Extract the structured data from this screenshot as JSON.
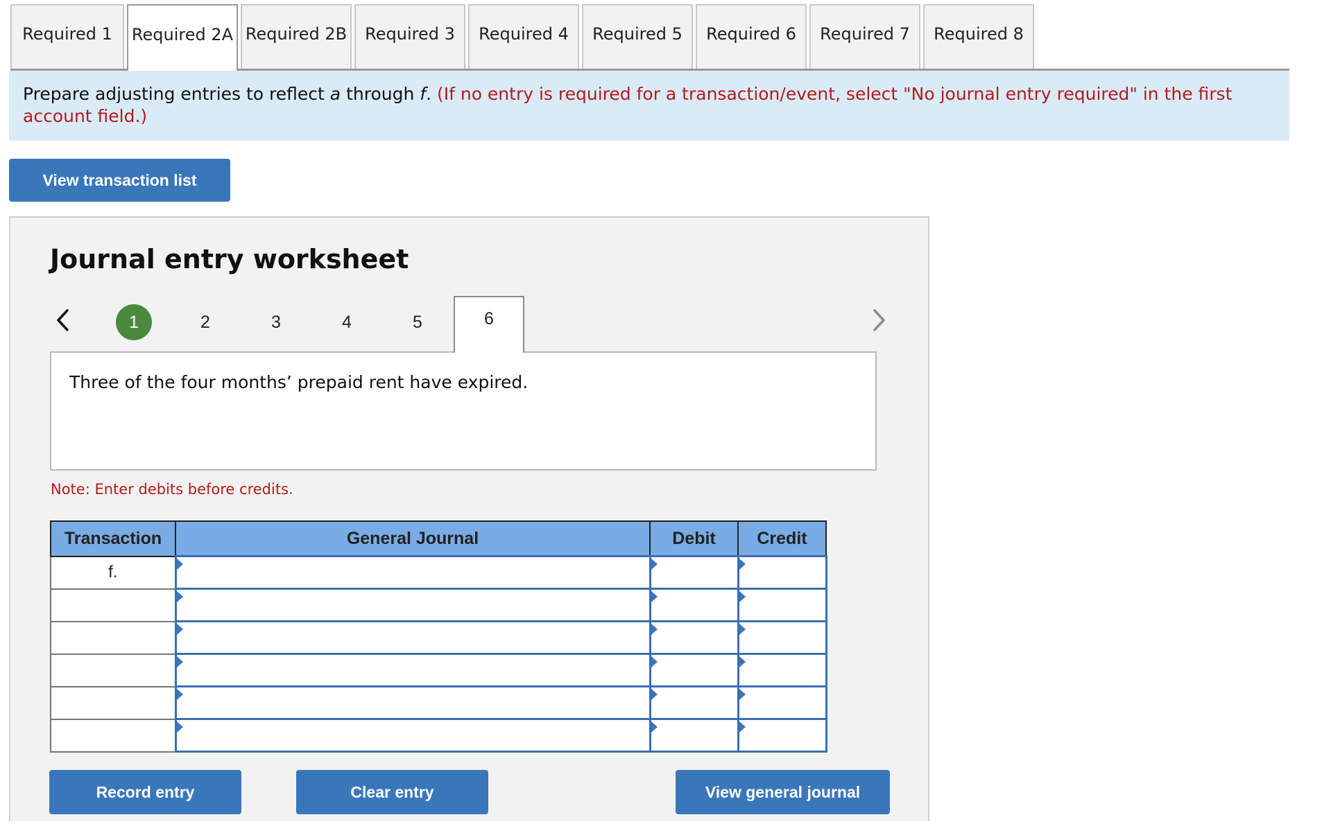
{
  "tabs": [
    {
      "label": "Required 1",
      "active": false
    },
    {
      "label": "Required 2A",
      "active": true
    },
    {
      "label": "Required 2B",
      "active": false
    },
    {
      "label": "Required 3",
      "active": false
    },
    {
      "label": "Required 4",
      "active": false
    },
    {
      "label": "Required 5",
      "active": false
    },
    {
      "label": "Required 6",
      "active": false
    },
    {
      "label": "Required 7",
      "active": false
    },
    {
      "label": "Required 8",
      "active": false
    }
  ],
  "instructions": {
    "part1": "Prepare adjusting entries to reflect ",
    "a": "a",
    "part2": " through ",
    "f": "f",
    "part3": ". ",
    "red": "(If no entry is required for a transaction/event, select \"No journal entry required\" in the first account field.)"
  },
  "view_transaction_list_label": "View transaction list",
  "worksheet": {
    "title": "Journal entry worksheet",
    "pager": {
      "prev_icon": "chevron-left-icon",
      "next_icon": "chevron-right-icon",
      "pages": [
        "1",
        "2",
        "3",
        "4",
        "5",
        "6"
      ],
      "completed": [
        "1"
      ],
      "current": "6"
    },
    "description": "Three of the four months’ prepaid rent have expired.",
    "note": "Note: Enter debits before credits.",
    "table": {
      "headers": [
        "Transaction",
        "General Journal",
        "Debit",
        "Credit"
      ],
      "rows": [
        {
          "transaction": "f.",
          "account": "",
          "debit": "",
          "credit": ""
        },
        {
          "transaction": "",
          "account": "",
          "debit": "",
          "credit": ""
        },
        {
          "transaction": "",
          "account": "",
          "debit": "",
          "credit": ""
        },
        {
          "transaction": "",
          "account": "",
          "debit": "",
          "credit": ""
        },
        {
          "transaction": "",
          "account": "",
          "debit": "",
          "credit": ""
        },
        {
          "transaction": "",
          "account": "",
          "debit": "",
          "credit": ""
        }
      ]
    },
    "buttons": {
      "record": "Record entry",
      "clear": "Clear entry",
      "view_journal": "View general journal"
    }
  },
  "colors": {
    "button_blue": "#3a77ba",
    "header_blue": "#79ace4",
    "instructions_bg": "#daebf8",
    "alert_red": "#b31b1b",
    "completed_green": "#4b8a3e"
  }
}
